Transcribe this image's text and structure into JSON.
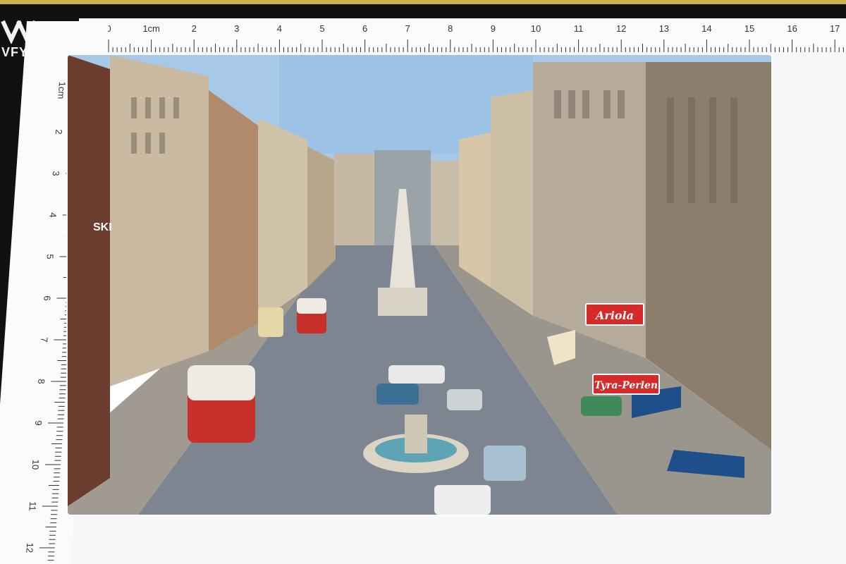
{
  "watermark": {
    "text": "VFY",
    "icon": "watermark-logo-icon"
  },
  "ruler_top": {
    "labels": [
      "0",
      "1cm",
      "2",
      "3",
      "4",
      "5",
      "6",
      "7",
      "8",
      "9",
      "10",
      "11",
      "12",
      "13",
      "14",
      "15",
      "16",
      "17"
    ]
  },
  "ruler_left": {
    "labels": [
      "1cm",
      "2",
      "3",
      "4",
      "5",
      "6",
      "7",
      "8",
      "9",
      "10",
      "11",
      "12"
    ]
  },
  "photo": {
    "signs": {
      "ariola": "Ariola",
      "tyra": "Tyra-Perlen",
      "ski": "SKI"
    }
  },
  "colors": {
    "sky": "#9cc3e6",
    "street": "#7d8590",
    "bus_red": "#c8302c",
    "sign_red": "#d42a2a"
  }
}
